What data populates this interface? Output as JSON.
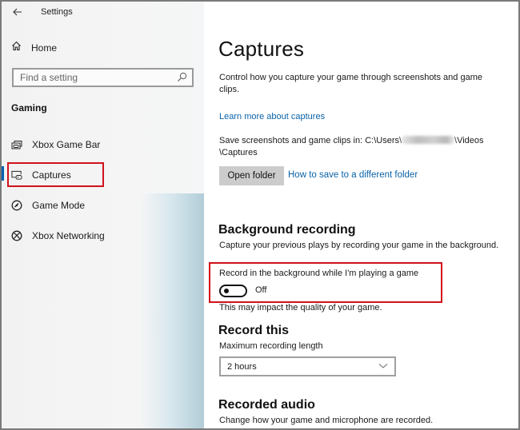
{
  "window": {
    "title": "Settings"
  },
  "sidebar": {
    "home_label": "Home",
    "search": {
      "placeholder": "Find a setting",
      "value": ""
    },
    "section_title": "Gaming",
    "items": [
      {
        "label": "Xbox Game Bar",
        "icon": "xbox-game-bar-icon"
      },
      {
        "label": "Captures",
        "icon": "captures-icon",
        "selected": true,
        "highlighted": true
      },
      {
        "label": "Game Mode",
        "icon": "game-mode-icon"
      },
      {
        "label": "Xbox Networking",
        "icon": "xbox-icon"
      }
    ],
    "accent_color": "#0063b1"
  },
  "main": {
    "title": "Captures",
    "description": "Control how you capture your game through screenshots and game clips.",
    "learn_more_link": "Learn more about captures",
    "save_location": {
      "prefix": "Save screenshots and game clips in: C:\\Users\\",
      "suffix": "\\Videos \\Captures"
    },
    "open_folder_button": "Open folder",
    "how_to_link": "How to save to a different folder",
    "background_recording": {
      "heading": "Background recording",
      "description": "Capture your previous plays by recording your game in the background.",
      "toggle_label": "Record in the background while I'm playing a game",
      "toggle_state": "Off",
      "toggle_on": false,
      "note": "This may impact the quality of your game."
    },
    "record_this": {
      "heading": "Record this",
      "max_length_label": "Maximum recording length",
      "max_length_value": "2 hours"
    },
    "recorded_audio": {
      "heading": "Recorded audio",
      "description": "Change how your game and microphone are recorded."
    }
  },
  "colors": {
    "link": "#0a62a8",
    "highlight_box": "#d0121b",
    "button_bg": "#cccccc"
  }
}
